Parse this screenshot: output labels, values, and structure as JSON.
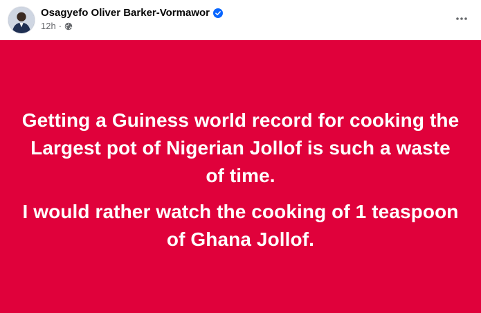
{
  "post": {
    "author_name": "Osagyefo Oliver Barker-Vormawor",
    "timestamp": "12h",
    "separator": "·",
    "audience_icon": "globe-icon",
    "verified_icon": "verified-badge-icon",
    "more_icon": "more-options-icon",
    "background_color": "#e0013b",
    "paragraphs": [
      "Getting a Guiness world record for cooking the Largest pot of Nigerian Jollof is such a waste of time.",
      "I would rather watch the cooking of 1 teaspoon of Ghana Jollof."
    ]
  }
}
